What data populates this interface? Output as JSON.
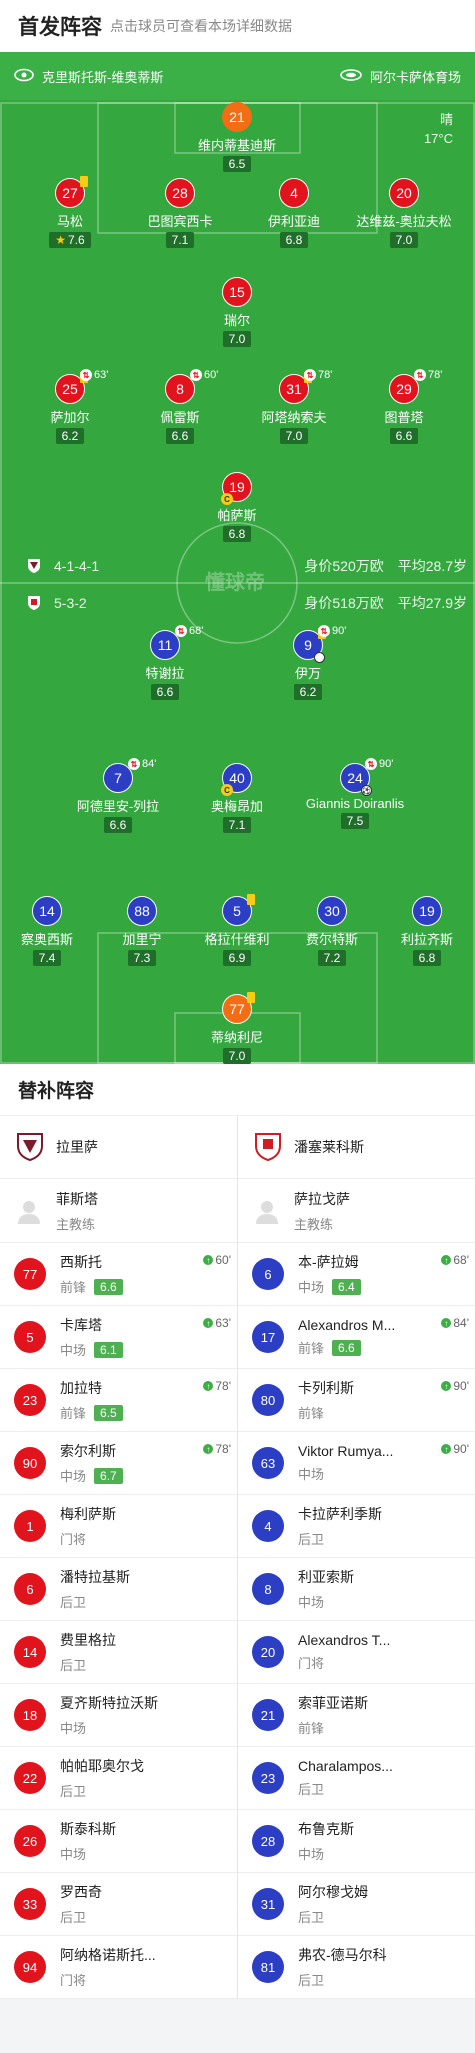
{
  "header": {
    "title": "首发阵容",
    "subtitle": "点击球员可查看本场详细数据"
  },
  "venue": {
    "home_team": "克里斯托斯-维奥蒂斯",
    "stadium": "阿尔卡萨体育场"
  },
  "weather": {
    "condition": "晴",
    "temp": "17°C"
  },
  "home_info": {
    "formation": "4-1-4-1",
    "value": "身价520万欧",
    "age": "平均28.7岁"
  },
  "away_info": {
    "formation": "5-3-2",
    "value": "身价518万欧",
    "age": "平均27.9岁"
  },
  "watermark": "懂球帝",
  "home_players": [
    {
      "num": "21",
      "name": "维内蒂基迪斯",
      "rating": "6.5"
    },
    {
      "num": "27",
      "name": "马松",
      "rating": "7.6",
      "yellow": true,
      "star": true
    },
    {
      "num": "28",
      "name": "巴图宾西卡",
      "rating": "7.1"
    },
    {
      "num": "4",
      "name": "伊利亚迪",
      "rating": "6.8"
    },
    {
      "num": "20",
      "name": "达维兹-奥拉夫松",
      "rating": "7.0"
    },
    {
      "num": "15",
      "name": "瑞尔",
      "rating": "7.0"
    },
    {
      "num": "25",
      "name": "萨加尔",
      "rating": "6.2",
      "yellow": true,
      "sub": "63'"
    },
    {
      "num": "8",
      "name": "佩雷斯",
      "rating": "6.6",
      "sub": "60'"
    },
    {
      "num": "31",
      "name": "阿塔纳索夫",
      "rating": "7.0",
      "yellow": true,
      "sub": "78'"
    },
    {
      "num": "29",
      "name": "图普塔",
      "rating": "6.6",
      "sub": "78'"
    },
    {
      "num": "19",
      "name": "帕萨斯",
      "rating": "6.8",
      "captain": true
    }
  ],
  "away_players": [
    {
      "num": "11",
      "name": "特谢拉",
      "rating": "6.6",
      "sub": "68'"
    },
    {
      "num": "9",
      "name": "伊万",
      "rating": "6.2",
      "yellow": true,
      "sub": "90'"
    },
    {
      "num": "7",
      "name": "阿德里安-列拉",
      "rating": "6.6",
      "sub": "84'"
    },
    {
      "num": "40",
      "name": "奥梅昂加",
      "rating": "7.1",
      "captain": true
    },
    {
      "num": "24",
      "name": "Giannis Doiranlis",
      "rating": "7.5",
      "sub": "90'",
      "goal": true
    },
    {
      "num": "14",
      "name": "察奥西斯",
      "rating": "7.4"
    },
    {
      "num": "88",
      "name": "加里宁",
      "rating": "7.3"
    },
    {
      "num": "5",
      "name": "格拉什维利",
      "rating": "6.9",
      "yellow": true
    },
    {
      "num": "30",
      "name": "费尔特斯",
      "rating": "7.2"
    },
    {
      "num": "19",
      "name": "利拉齐斯",
      "rating": "6.8"
    },
    {
      "num": "77",
      "name": "蒂纳利尼",
      "rating": "7.0",
      "yellow": true
    }
  ],
  "subs": {
    "title": "替补阵容",
    "home": {
      "team": "拉里萨",
      "coach_name": "菲斯塔",
      "coach_role": "主教练",
      "players": [
        {
          "num": "77",
          "name": "西斯托",
          "pos": "前锋",
          "rating": "6.6",
          "min": "60'"
        },
        {
          "num": "5",
          "name": "卡库塔",
          "pos": "中场",
          "rating": "6.1",
          "min": "63'"
        },
        {
          "num": "23",
          "name": "加拉特",
          "pos": "前锋",
          "rating": "6.5",
          "min": "78'"
        },
        {
          "num": "90",
          "name": "索尔利斯",
          "pos": "中场",
          "rating": "6.7",
          "min": "78'"
        },
        {
          "num": "1",
          "name": "梅利萨斯",
          "pos": "门将"
        },
        {
          "num": "6",
          "name": "潘特拉基斯",
          "pos": "后卫"
        },
        {
          "num": "14",
          "name": "费里格拉",
          "pos": "后卫"
        },
        {
          "num": "18",
          "name": "夏齐斯特拉沃斯",
          "pos": "中场"
        },
        {
          "num": "22",
          "name": "帕帕耶奥尔戈",
          "pos": "后卫"
        },
        {
          "num": "26",
          "name": "斯泰科斯",
          "pos": "中场"
        },
        {
          "num": "33",
          "name": "罗西奇",
          "pos": "后卫"
        },
        {
          "num": "94",
          "name": "阿纳格诺斯托...",
          "pos": "门将"
        }
      ]
    },
    "away": {
      "team": "潘塞莱科斯",
      "coach_name": "萨拉戈萨",
      "coach_role": "主教练",
      "players": [
        {
          "num": "6",
          "name": "本-萨拉姆",
          "pos": "中场",
          "rating": "6.4",
          "min": "68'"
        },
        {
          "num": "17",
          "name": "Alexandros M...",
          "pos": "前锋",
          "rating": "6.6",
          "min": "84'"
        },
        {
          "num": "80",
          "name": "卡列利斯",
          "pos": "前锋",
          "min": "90'"
        },
        {
          "num": "63",
          "name": "Viktor Rumya...",
          "pos": "中场",
          "min": "90'"
        },
        {
          "num": "4",
          "name": "卡拉萨利季斯",
          "pos": "后卫"
        },
        {
          "num": "8",
          "name": "利亚索斯",
          "pos": "中场"
        },
        {
          "num": "20",
          "name": "Alexandros T...",
          "pos": "门将"
        },
        {
          "num": "21",
          "name": "索菲亚诺斯",
          "pos": "前锋"
        },
        {
          "num": "23",
          "name": "Charalampos...",
          "pos": "后卫"
        },
        {
          "num": "28",
          "name": "布鲁克斯",
          "pos": "中场"
        },
        {
          "num": "31",
          "name": "阿尔穆戈姆",
          "pos": "后卫"
        },
        {
          "num": "81",
          "name": "弗农-德马尔科",
          "pos": "后卫"
        }
      ]
    }
  },
  "colors": {
    "home": "#e1131c",
    "away": "#2b3ec4",
    "keeper": "#f26d14",
    "pitch": "#35a73f"
  }
}
